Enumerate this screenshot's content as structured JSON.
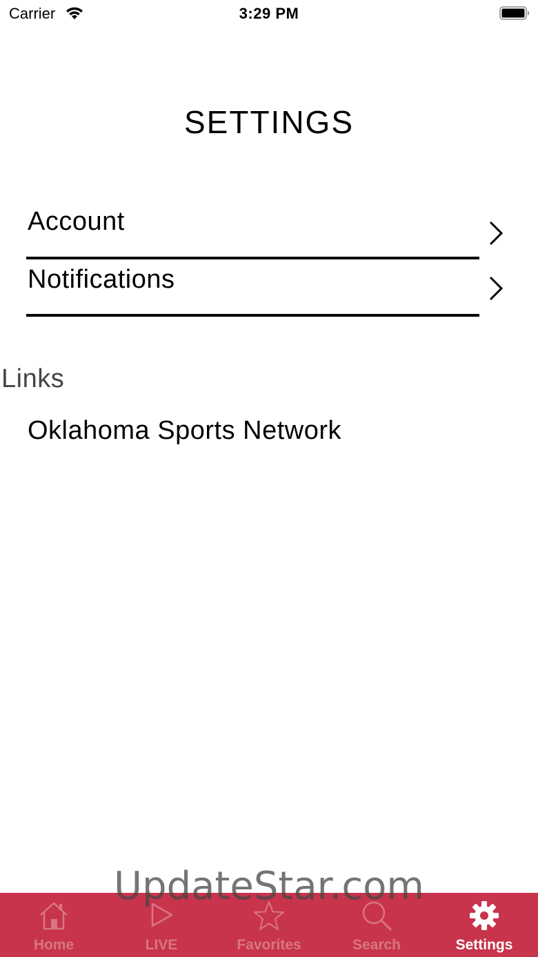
{
  "status_bar": {
    "carrier": "Carrier",
    "time": "3:29 PM"
  },
  "page": {
    "title": "SETTINGS"
  },
  "settings": {
    "items": [
      {
        "label": "Account"
      },
      {
        "label": "Notifications"
      }
    ]
  },
  "links": {
    "header": "Links",
    "items": [
      {
        "label": "Oklahoma Sports Network"
      }
    ]
  },
  "watermark": "UpdateStar.com",
  "tab_bar": {
    "background_color": "#C8344B",
    "active_color": "#FFFFFF",
    "inactive_color": "#D87585",
    "tabs": [
      {
        "label": "Home",
        "icon": "home-icon",
        "active": false
      },
      {
        "label": "LIVE",
        "icon": "play-icon",
        "active": false
      },
      {
        "label": "Favorites",
        "icon": "star-icon",
        "active": false
      },
      {
        "label": "Search",
        "icon": "search-icon",
        "active": false
      },
      {
        "label": "Settings",
        "icon": "gear-icon",
        "active": true
      }
    ]
  }
}
